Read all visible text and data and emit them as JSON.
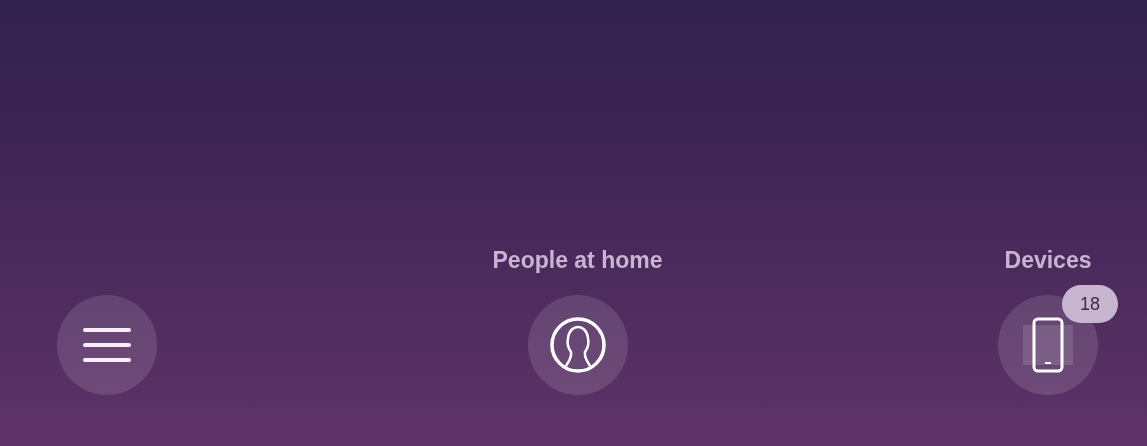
{
  "nav_items": [
    {
      "kind": "menu"
    },
    {
      "kind": "people",
      "label": "People at home"
    },
    {
      "kind": "devices",
      "label": "Devices",
      "badge": "18"
    }
  ]
}
